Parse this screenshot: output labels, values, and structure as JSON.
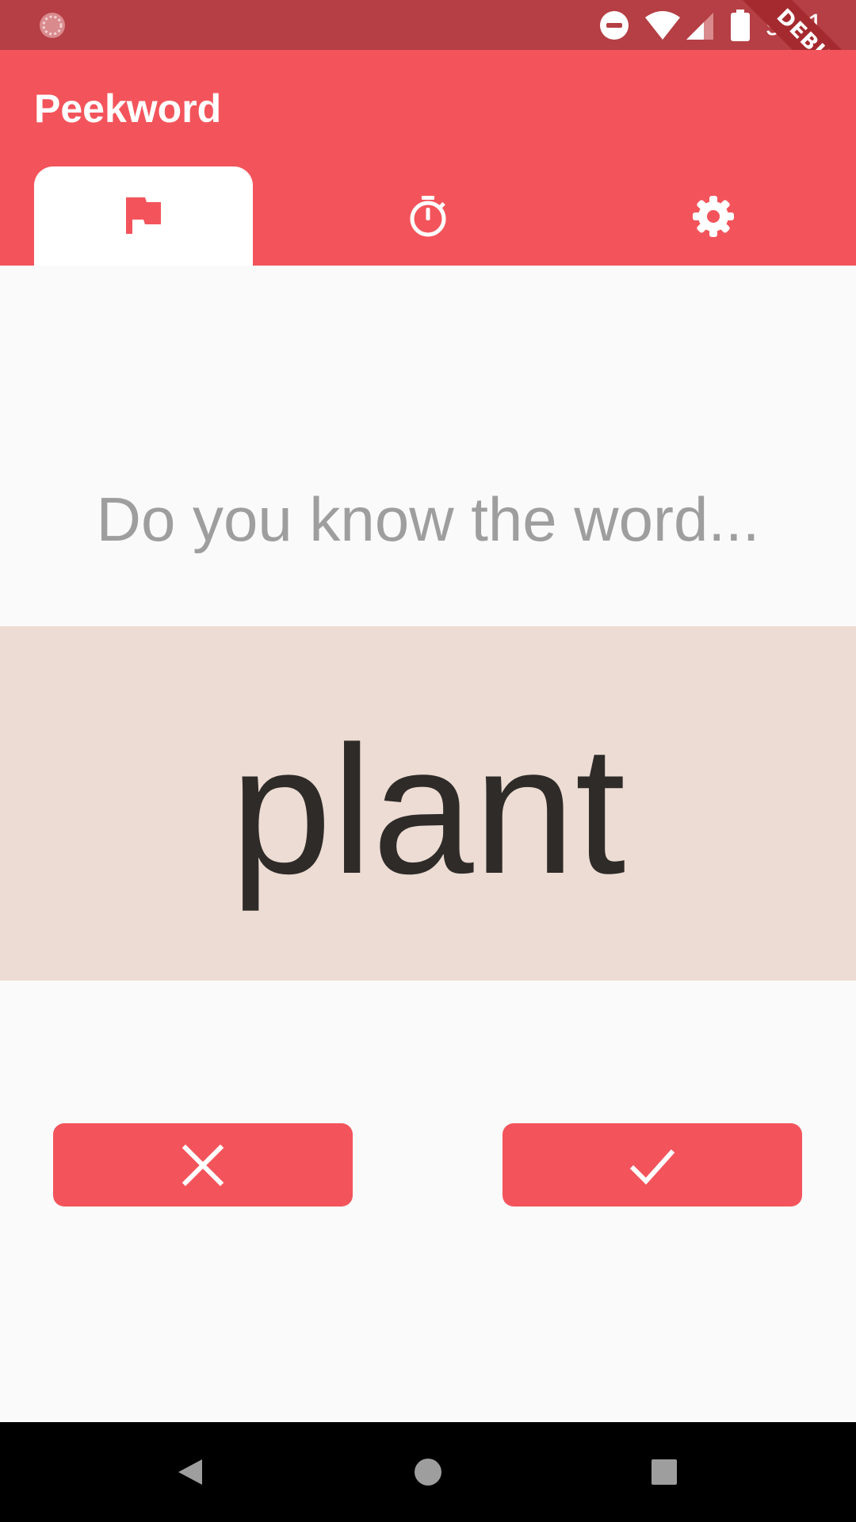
{
  "status_bar": {
    "time": "9:21",
    "icons": [
      "app-notification-icon",
      "do-not-disturb-icon",
      "wifi-icon",
      "cell-signal-icon",
      "battery-icon"
    ]
  },
  "debug_banner": {
    "label": "DEBUG"
  },
  "app_bar": {
    "title": "Peekword",
    "tabs": [
      {
        "icon": "flag-icon",
        "selected": true
      },
      {
        "icon": "timer-icon",
        "selected": false
      },
      {
        "icon": "settings-icon",
        "selected": false
      }
    ]
  },
  "quiz": {
    "prompt": "Do you know the word...",
    "word": "plant",
    "buttons": [
      {
        "icon": "close-icon",
        "meaning": "don't know"
      },
      {
        "icon": "check-icon",
        "meaning": "know"
      }
    ]
  },
  "nav_bar": {
    "buttons": [
      "back-icon",
      "home-icon",
      "recents-icon"
    ]
  },
  "colors": {
    "status_bar": "#b53f44",
    "accent": "#f3545b",
    "word_card": "#eddcd3",
    "prompt_text": "#9e9e9e",
    "word_text": "#2e2b29",
    "background": "#fafafa"
  }
}
